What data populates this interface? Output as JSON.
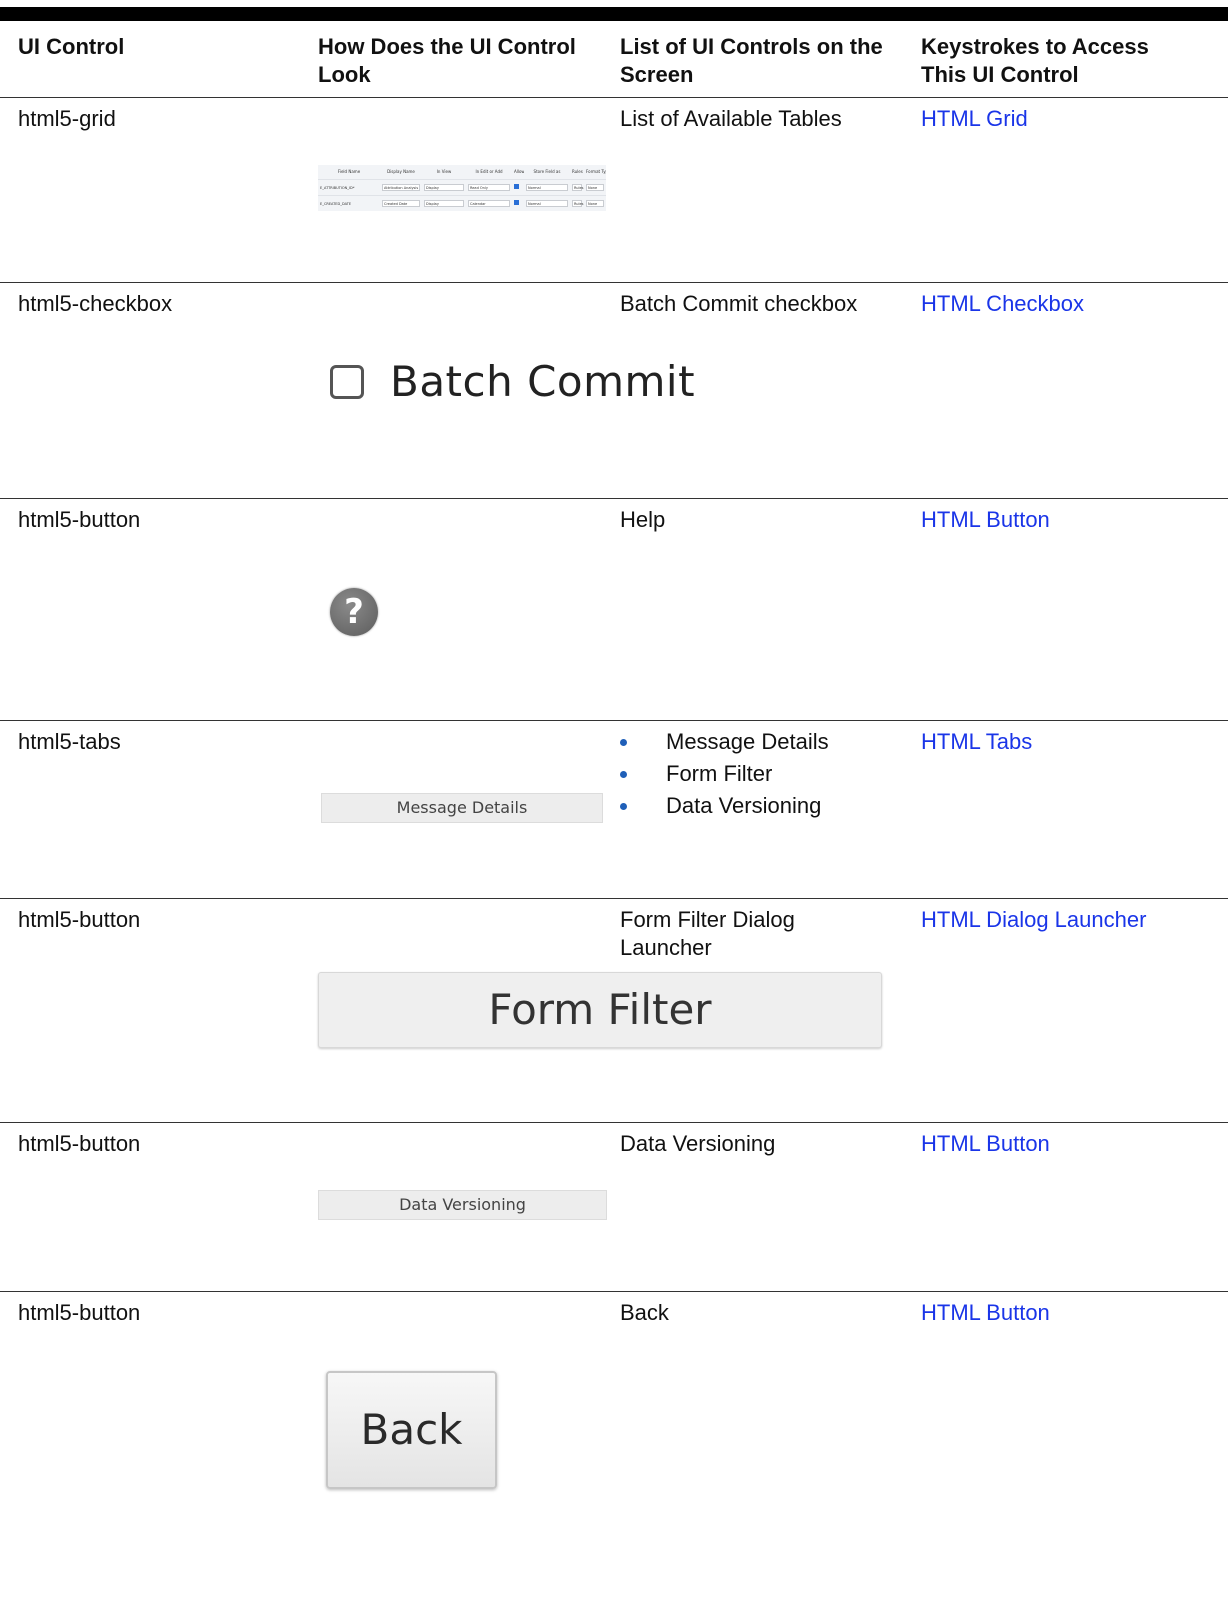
{
  "header": {
    "col1": "UI Control",
    "col2_line1": "How Does the UI Control",
    "col2_line2": "Look",
    "col3_line1": "List of UI Controls on the",
    "col3_line2": "Screen",
    "col4_line1": "Keystrokes to Access",
    "col4_line2": "This UI Control"
  },
  "rows": [
    {
      "control": "html5-grid",
      "list": "List of Available Tables",
      "link": "HTML Grid",
      "grid": {
        "headers": [
          "Field Name",
          "Display Name",
          "In View",
          "In Edit or Add",
          "Allow Add",
          "Store Field as",
          "Rules",
          "Format Type"
        ],
        "rows": [
          [
            "E_ATTRIBUTION_ID*",
            "Attribution Analysis",
            "Display",
            "Read Only",
            "",
            "Normal",
            "Rules",
            "None"
          ],
          [
            "E_CREATED_DATE",
            "Created Date",
            "Display",
            "Calendar",
            "",
            "Normal",
            "Rules",
            "None"
          ]
        ]
      }
    },
    {
      "control": "html5-checkbox",
      "list": "Batch Commit checkbox",
      "link": "HTML Checkbox",
      "visual_label": "Batch Commit"
    },
    {
      "control": "html5-button",
      "list": "Help",
      "link": "HTML Button",
      "visual_label": "?"
    },
    {
      "control": "html5-tabs",
      "list_items": [
        "Message Details",
        "Form Filter",
        "Data Versioning"
      ],
      "link": "HTML Tabs",
      "visual_label": "Message Details"
    },
    {
      "control": "html5-button",
      "list_line1": "Form Filter Dialog",
      "list_line2": "Launcher",
      "link": "HTML Dialog Launcher",
      "visual_label": "Form Filter"
    },
    {
      "control": "html5-button",
      "list": "Data Versioning",
      "link": "HTML Button",
      "visual_label": "Data Versioning"
    },
    {
      "control": "html5-button",
      "list": "Back",
      "link": "HTML Button",
      "visual_label": "Back"
    }
  ],
  "colors": {
    "link": "#1a35e8",
    "bullet": "#1f5fb8",
    "rule": "#000000"
  }
}
